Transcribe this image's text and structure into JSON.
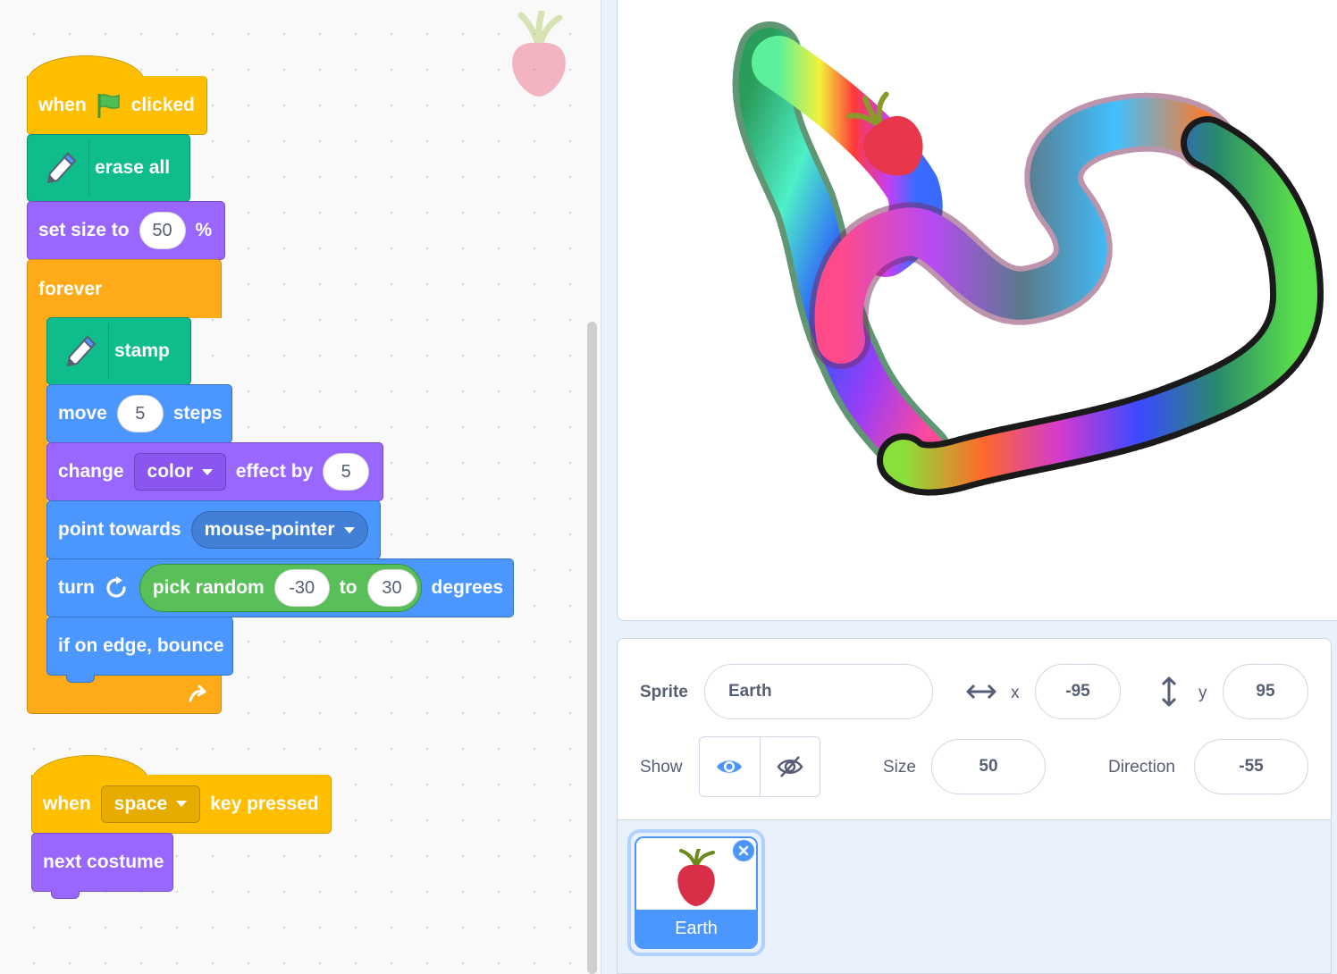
{
  "scripts": {
    "flag_script": {
      "when": "when",
      "clicked": "clicked",
      "erase_all": "erase all",
      "set_size_to": "set size to",
      "size_value": "50",
      "percent": "%",
      "forever": "forever",
      "stamp": "stamp",
      "move": "move",
      "move_value": "5",
      "steps": "steps",
      "change": "change",
      "effect_option": "color",
      "effect_by": "effect by",
      "effect_value": "5",
      "point_towards": "point towards",
      "towards_option": "mouse-pointer",
      "turn": "turn",
      "pick_random": "pick random",
      "random_from": "-30",
      "to": "to",
      "random_to": "30",
      "degrees": "degrees",
      "bounce": "if on edge, bounce"
    },
    "key_script": {
      "when": "when",
      "key_option": "space",
      "key_pressed": "key pressed",
      "next_costume": "next costume"
    }
  },
  "sprite_info": {
    "sprite_label": "Sprite",
    "sprite_name": "Earth",
    "x_label": "x",
    "x_value": "-95",
    "y_label": "y",
    "y_value": "95",
    "show_label": "Show",
    "size_label": "Size",
    "size_value": "50",
    "direction_label": "Direction",
    "direction_value": "-55"
  },
  "sprite_list": {
    "items": [
      {
        "name": "Earth"
      }
    ]
  },
  "colors": {
    "events": "#ffbf00",
    "pen": "#0fbd8c",
    "looks": "#9966ff",
    "control": "#ffab19",
    "motion": "#4c97ff",
    "operators": "#59c059",
    "ui_blue": "#4c97ff"
  }
}
